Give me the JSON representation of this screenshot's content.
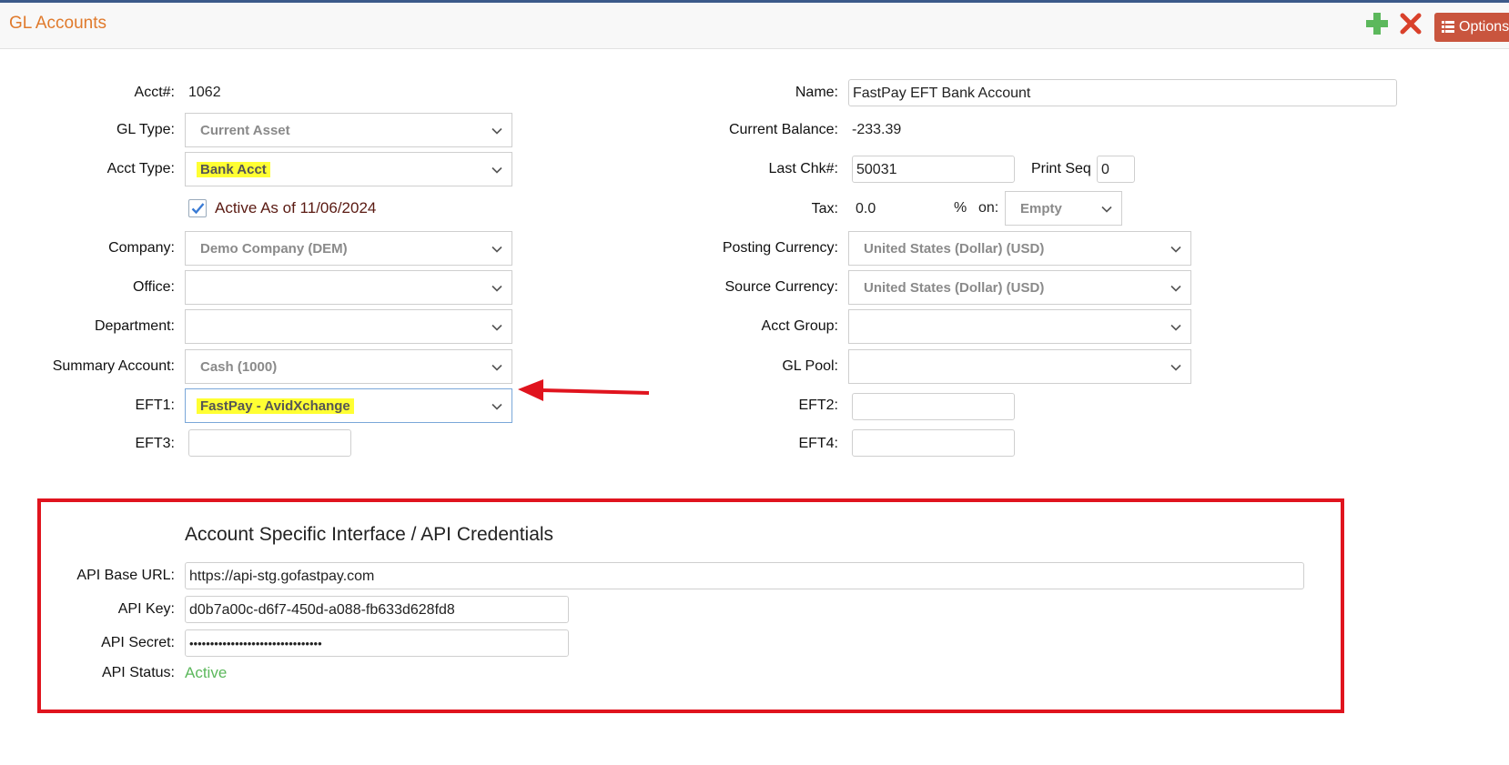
{
  "header": {
    "title": "GL Accounts",
    "options_label": "Options"
  },
  "left": {
    "acct_label": "Acct#:",
    "acct_value": "1062",
    "gl_type_label": "GL Type:",
    "gl_type_value": "Current Asset",
    "acct_type_label": "Acct Type:",
    "acct_type_value": "Bank Acct",
    "active_label": "Active As of 11/06/2024",
    "company_label": "Company:",
    "company_value": "Demo Company (DEM)",
    "office_label": "Office:",
    "office_value": "",
    "department_label": "Department:",
    "department_value": "",
    "summary_label": "Summary Account:",
    "summary_value": "Cash (1000)",
    "eft1_label": "EFT1:",
    "eft1_value": "FastPay - AvidXchange",
    "eft3_label": "EFT3:",
    "eft3_value": ""
  },
  "right": {
    "name_label": "Name:",
    "name_value": "FastPay EFT Bank Account",
    "balance_label": "Current Balance:",
    "balance_value": "-233.39",
    "last_chk_label": "Last Chk#:",
    "last_chk_value": "50031",
    "print_seq_label": "Print Seq",
    "print_seq_value": "0",
    "tax_label": "Tax:",
    "tax_value": "0.0",
    "tax_percent": "%",
    "tax_on_label": "on:",
    "tax_on_value": "Empty",
    "posting_currency_label": "Posting Currency:",
    "posting_currency_value": "United States (Dollar) (USD)",
    "source_currency_label": "Source Currency:",
    "source_currency_value": "United States (Dollar) (USD)",
    "acct_group_label": "Acct Group:",
    "acct_group_value": "",
    "gl_pool_label": "GL Pool:",
    "gl_pool_value": "",
    "eft2_label": "EFT2:",
    "eft2_value": "",
    "eft4_label": "EFT4:",
    "eft4_value": ""
  },
  "api": {
    "title": "Account Specific Interface / API Credentials",
    "base_url_label": "API Base URL:",
    "base_url_value": "https://api-stg.gofastpay.com",
    "key_label": "API Key:",
    "key_value": "d0b7a00c-d6f7-450d-a088-fb633d628fd8",
    "secret_label": "API Secret:",
    "secret_value": "••••••••••••••••••••••••••••••••",
    "status_label": "API Status:",
    "status_value": "Active"
  },
  "colors": {
    "title_orange": "#e07a2c",
    "add_green": "#5cb85c",
    "close_red": "#d9412b",
    "options_bg": "#c9553e",
    "highlight_yellow": "#ffff33",
    "annotation_red": "#e0141e",
    "status_green": "#5cb85c"
  },
  "icons": [
    "plus-icon",
    "close-icon",
    "list-icon",
    "chevron-down-icon",
    "checkmark-icon",
    "red-arrow-annotation"
  ]
}
